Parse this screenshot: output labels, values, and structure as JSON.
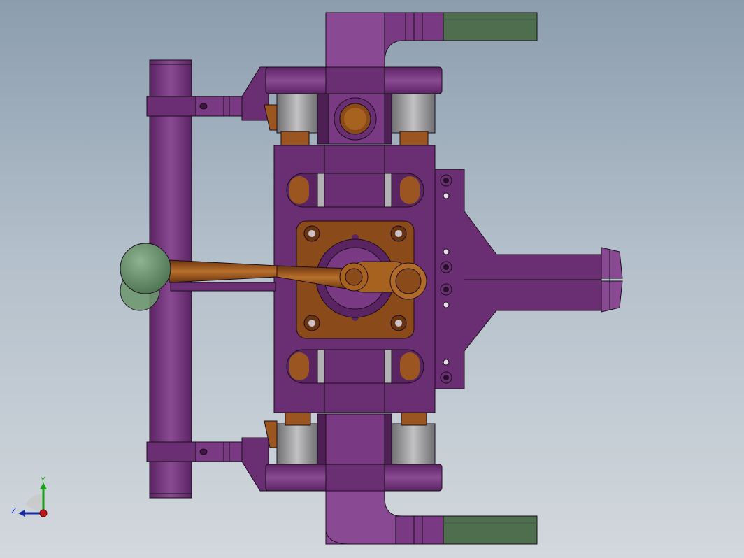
{
  "viewport": {
    "background_top": "#8c9dae",
    "background_bottom": "#d2d8dd"
  },
  "colors": {
    "purple": "#6a2e72",
    "purple_light": "#8a4a93",
    "purple_dark": "#4e1f55",
    "green": "#4e6e4e",
    "green_ball": "#5f8a63",
    "bronze": "#8a4a1a",
    "bronze_light": "#b06a2a",
    "bronze_dark": "#6a3410",
    "gray_roller": "#8e8e90",
    "gray_roller_light": "#b3b3b5",
    "edge": "#1a0e1c"
  },
  "triad": {
    "y_label": "Y",
    "z_label": "Z",
    "y_color": "#1aa01a",
    "z_color": "#1a2aa0",
    "x_color": "#c01a1a"
  }
}
